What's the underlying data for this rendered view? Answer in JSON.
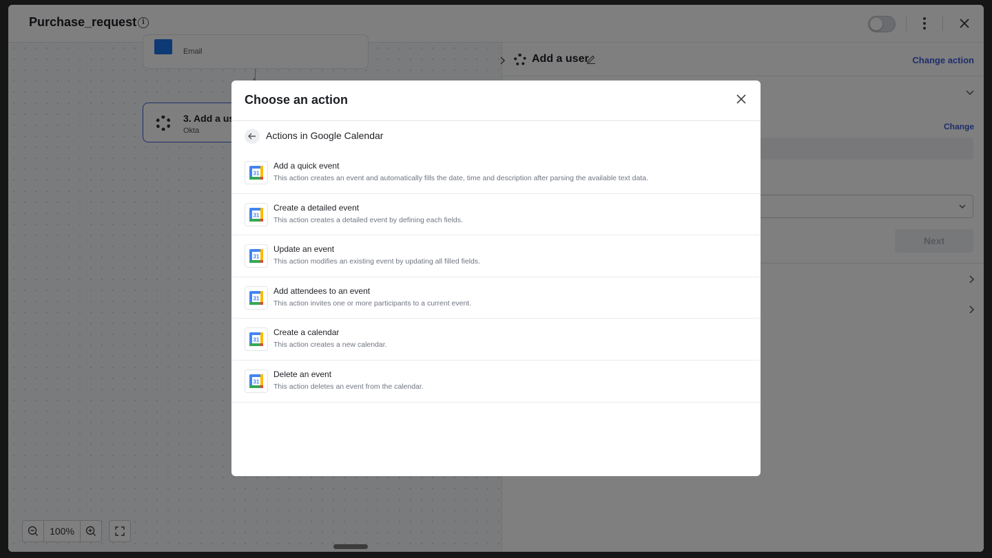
{
  "window": {
    "title": "Purchase_request"
  },
  "canvas": {
    "node1_subtitle": "Email",
    "node3_title": "3. Add a us",
    "node3_subtitle": "Okta",
    "zoom_level": "100%"
  },
  "panel": {
    "title": "Add a user",
    "change_action_label": "Change action",
    "change_label": "Change",
    "next_label": "Next"
  },
  "modal": {
    "title": "Choose an action",
    "section_title": "Actions in Google Calendar",
    "actions": [
      {
        "title": "Add a quick event",
        "description": "This action creates an event and automatically fills the date, time and description after parsing the available text data."
      },
      {
        "title": "Create a detailed event",
        "description": "This action creates a detailed event by defining each fields."
      },
      {
        "title": "Update an event",
        "description": "This action modifies an existing event by updating all filled fields."
      },
      {
        "title": "Add attendees to an event",
        "description": "This action invites one or more participants to a current event."
      },
      {
        "title": "Create a calendar",
        "description": "This action creates a new calendar."
      },
      {
        "title": "Delete an event",
        "description": "This action deletes an event from the calendar."
      }
    ]
  },
  "icons": {
    "calendar": "google-calendar-icon",
    "back": "arrow-left-icon",
    "close": "close-icon"
  },
  "colors": {
    "accent": "#3d5bd9",
    "gcal_blue": "#4285f4",
    "gcal_green": "#34a853",
    "gcal_yellow": "#fbbc04",
    "gcal_red": "#ea4335"
  }
}
